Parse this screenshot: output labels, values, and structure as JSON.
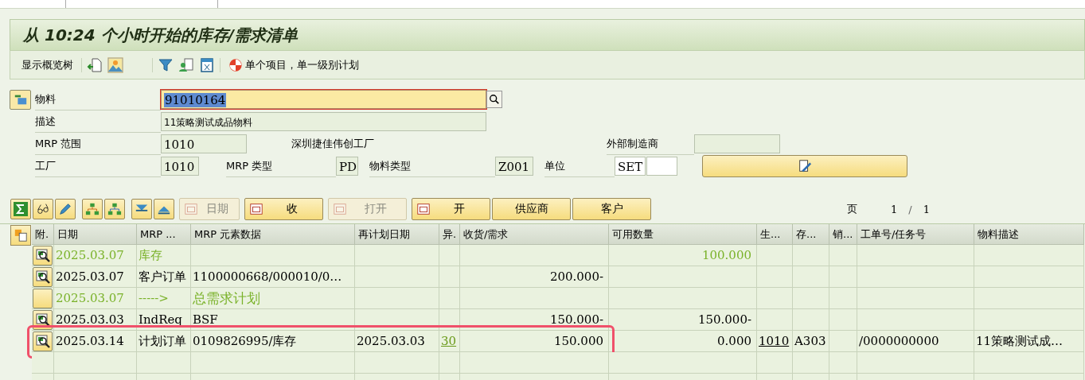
{
  "title": "从 10:24 个小时开始的库存/需求清单",
  "toolbar": {
    "overview": "显示概览树",
    "single": "单个项目，单一级别计划"
  },
  "form": {
    "material_label": "物料",
    "material": "91010164",
    "desc_label": "描述",
    "desc": "11策略测试成品物料",
    "mrp_area_label": "MRP 范围",
    "mrp_area": "1010",
    "plant_name": "深圳捷佳伟创工厂",
    "ext_label": "外部制造商",
    "plant_label": "工厂",
    "plant": "1010",
    "mrp_type_label": "MRP 类型",
    "mrp_type": "PD",
    "mat_type_label": "物料类型",
    "mat_type": "Z001",
    "unit_label": "单位",
    "unit": "SET"
  },
  "table_buttons": [
    {
      "label": "日期",
      "disabled": true
    },
    {
      "label": "收",
      "disabled": false
    },
    {
      "label": "打开",
      "disabled": true
    },
    {
      "label": "开",
      "disabled": false
    },
    {
      "label": "供应商",
      "disabled": false
    },
    {
      "label": "客户",
      "disabled": false
    }
  ],
  "page": {
    "label": "页",
    "current": "1",
    "separator": "/",
    "total": "1"
  },
  "columns": [
    "附.",
    "日期",
    "MRP ...",
    "MRP 元素数据",
    "再计划日期",
    "异.",
    "收货/需求",
    "可用数量",
    "生...",
    "存...",
    "销...",
    "工单号/任务号",
    "物料描述"
  ],
  "rows": [
    {
      "kind": "stock",
      "date": "2025.03.07",
      "mrp": "库存",
      "element": "",
      "reschedule": "",
      "exception": "",
      "qty": "",
      "available": "100.000",
      "plant": "",
      "storage": "",
      "sales": "",
      "order": "",
      "desc": ""
    },
    {
      "kind": "item",
      "date": "2025.03.07",
      "mrp": "客户订单",
      "element": "1100000668/000010/0…",
      "reschedule": "",
      "exception": "",
      "qty": "200.000-",
      "available": "",
      "plant": "",
      "storage": "",
      "sales": "",
      "order": "",
      "desc": ""
    },
    {
      "kind": "total",
      "date": "2025.03.07",
      "mrp": "----->",
      "element": "总需求计划",
      "reschedule": "",
      "exception": "",
      "qty": "",
      "available": "",
      "plant": "",
      "storage": "",
      "sales": "",
      "order": "",
      "desc": ""
    },
    {
      "kind": "item",
      "date": "2025.03.03",
      "mrp": "IndReq",
      "element": "BSF",
      "reschedule": "",
      "exception": "",
      "qty": "150.000-",
      "available": "150.000-",
      "plant": "",
      "storage": "",
      "sales": "",
      "order": "",
      "desc": ""
    },
    {
      "kind": "item",
      "highlighted": true,
      "date": "2025.03.14",
      "mrp": "计划订单",
      "element": "0109826995/库存",
      "reschedule": "2025.03.03",
      "exception": "30",
      "qty": "150.000",
      "available": "0.000",
      "plant": "1010",
      "storage": "A303",
      "sales": "",
      "order": "/0000000000",
      "desc": "11策略测试成…",
      "exception_underlined": true,
      "plant_underlined": true
    }
  ]
}
